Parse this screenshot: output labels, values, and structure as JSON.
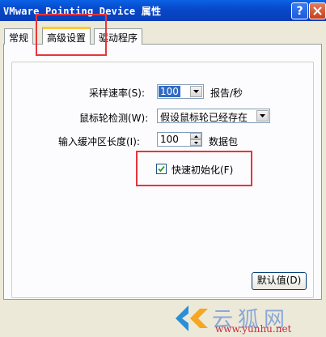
{
  "window": {
    "title": "VMware Pointing Device 属性",
    "help_glyph": "?"
  },
  "tabs": [
    {
      "label": "常规"
    },
    {
      "label": "高级设置"
    },
    {
      "label": "驱动程序"
    }
  ],
  "settings": {
    "sample_rate": {
      "label": "采样速率(S):",
      "value": "100",
      "unit": "报告/秒"
    },
    "wheel_detection": {
      "label": "鼠标轮检测(W):",
      "value": "假设鼠标轮已经存在"
    },
    "buffer_length": {
      "label": "输入缓冲区长度(I):",
      "value": "100",
      "unit": "数据包"
    },
    "fast_init": {
      "label": "快速初始化(F)",
      "checked": true
    }
  },
  "buttons": {
    "defaults": "默认值(D)"
  },
  "watermark": {
    "text": "云狐网",
    "url": "www.yunhu.net"
  },
  "colors": {
    "titlebar": "#0847c8",
    "highlight": "#e8353c",
    "selection": "#316ac5"
  }
}
